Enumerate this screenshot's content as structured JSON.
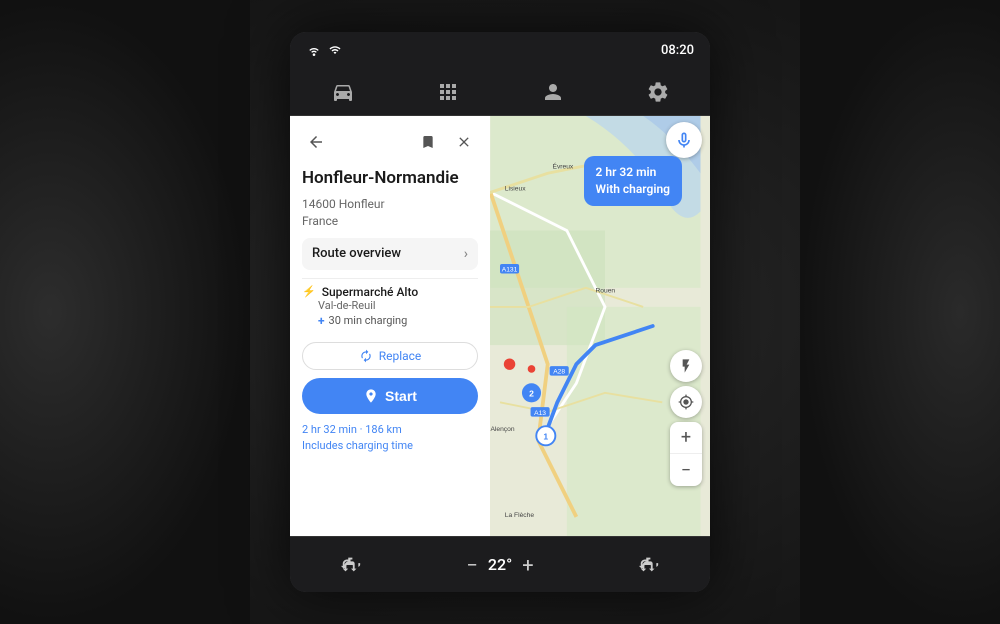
{
  "statusBar": {
    "time": "08:20",
    "wifiLabel": "wifi",
    "signalLabel": "signal"
  },
  "navBar": {
    "icons": [
      "car",
      "grid",
      "person",
      "settings"
    ]
  },
  "panel": {
    "locationTitle": "Honfleur-Normandie",
    "addressLine1": "14600 Honfleur",
    "addressLine2": "France",
    "routeOverviewLabel": "Route overview",
    "chargingStop": {
      "icon": "⚡",
      "name": "Supermarché Alto",
      "location": "Val-de-Reuil",
      "chargingTime": "30 min charging"
    },
    "replaceLabel": "Replace",
    "startLabel": "Start",
    "tripSummaryLine1": "2 hr 32 min · 186 km",
    "tripSummaryLine2": "Includes charging time"
  },
  "routeBubble": {
    "line1": "2 hr 32 min",
    "line2": "With charging"
  },
  "mapControls": {
    "locationIcon": "⊕",
    "zoomIn": "+",
    "zoomOut": "−",
    "flashIcon": "⚡"
  },
  "bottomBar": {
    "seatLeftLabel": "seat-left",
    "minusLabel": "−",
    "temperature": "22°",
    "plusLabel": "+",
    "seatRightLabel": "seat-right"
  },
  "voiceBtn": {
    "icon": "🎤"
  }
}
